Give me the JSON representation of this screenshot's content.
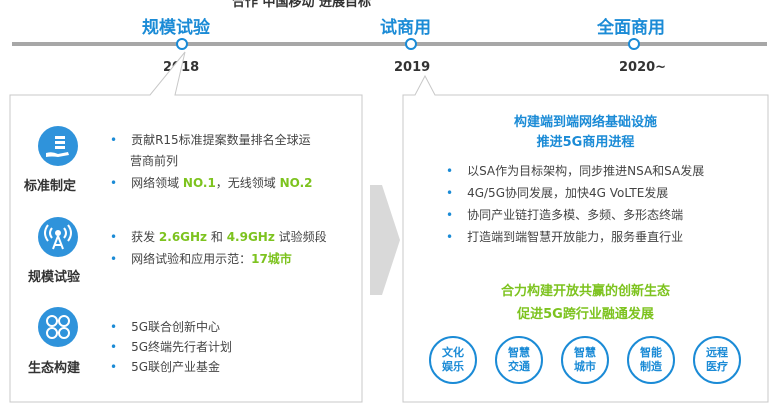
{
  "top_cut_text": "合作 中国移动 进展目标",
  "timeline": {
    "stages": [
      {
        "label": "规模试验",
        "year": "2018"
      },
      {
        "label": "试商用",
        "year": "2019"
      },
      {
        "label": "全面商用",
        "year": "2020~"
      }
    ]
  },
  "left_panel": {
    "categories": [
      {
        "label": "标准制定",
        "icon": "server-hand-icon",
        "bullets": [
          {
            "parts": [
              "贡献R15标准提案数量排名全球运"
            ]
          },
          {
            "parts": [
              "营商前列"
            ]
          },
          {
            "parts": [
              "网络领域 ",
              "NO.1",
              "，无线领域 ",
              "NO.2"
            ]
          }
        ]
      },
      {
        "label": "规模试验",
        "icon": "antenna-icon",
        "bullets": [
          {
            "parts": [
              "获发 ",
              "2.6GHz",
              " 和 ",
              "4.9GHz",
              " 试验频段"
            ]
          },
          {
            "parts": [
              "网络试验和应用示范：",
              "17城市"
            ]
          }
        ]
      },
      {
        "label": "生态构建",
        "icon": "ecosystem-icon",
        "bullets": [
          {
            "parts": [
              "5G联合创新中心"
            ]
          },
          {
            "parts": [
              "5G终端先行者计划"
            ]
          },
          {
            "parts": [
              "5G联创产业基金"
            ]
          }
        ]
      }
    ]
  },
  "right_panel": {
    "title1": "构建端到端网络基础设施",
    "title2": "推进5G商用进程",
    "bullets": [
      "以SA作为目标架构，同步推进NSA和SA发展",
      "4G/5G协同发展，加快4G VoLTE发展",
      "协同产业链打造多模、多频、多形态终端",
      "打造端到端智慧开放能力，服务垂直行业"
    ],
    "subtitle1": "合力构建开放共赢的创新生态",
    "subtitle2": "促进5G跨行业融通发展",
    "badges": [
      {
        "line1": "文化",
        "line2": "娱乐"
      },
      {
        "line1": "智慧",
        "line2": "交通"
      },
      {
        "line1": "智慧",
        "line2": "城市"
      },
      {
        "line1": "智能",
        "line2": "制造"
      },
      {
        "line1": "远程",
        "line2": "医疗"
      }
    ]
  },
  "colors": {
    "blue": "#1b8bd6",
    "green": "#7dc31f",
    "gray_line": "#a7a7a7"
  }
}
